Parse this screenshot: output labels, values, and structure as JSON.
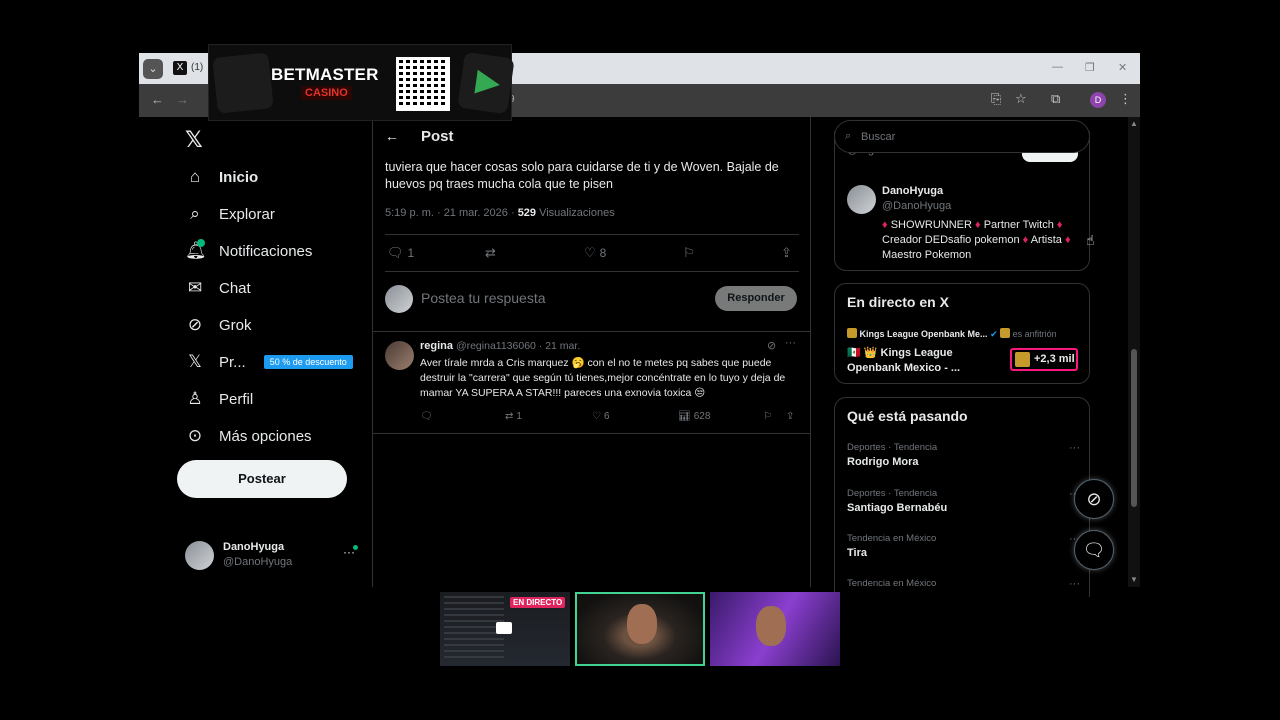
{
  "browser": {
    "tab_count": "(1)",
    "url_fragment": "9",
    "profile_initial": "D"
  },
  "ad": {
    "brand": "BETMASTER",
    "sub": "CASINO"
  },
  "sidebar": {
    "items": [
      {
        "label": "Inicio",
        "icon": "home-icon",
        "glyph": "⌂"
      },
      {
        "label": "Explorar",
        "icon": "search-icon",
        "glyph": "⌕"
      },
      {
        "label": "Notificaciones",
        "icon": "bell-icon",
        "glyph": "♫"
      },
      {
        "label": "Chat",
        "icon": "mail-icon",
        "glyph": "✉"
      },
      {
        "label": "Grok",
        "icon": "grok-icon",
        "glyph": "⊘"
      },
      {
        "label": "Pr...",
        "icon": "x-premium-icon",
        "glyph": "𝕏",
        "badge": "50 % de descuento"
      },
      {
        "label": "Perfil",
        "icon": "person-icon",
        "glyph": "♙"
      },
      {
        "label": "Más opciones",
        "icon": "more-circle-icon",
        "glyph": "⋯"
      }
    ],
    "post_button": "Postear",
    "account": {
      "name": "DanoHyuga",
      "handle": "@DanoHyuga"
    }
  },
  "post": {
    "header": "Post",
    "body": "tuviera que hacer cosas solo para cuidarse de ti y de Woven. Bajale de huevos pq traes mucha cola que te pisen",
    "time": "5:19 p. m. · 21 mar. 2026 · ",
    "views_count": "529",
    "views_label": " Visualizaciones",
    "replies": "1",
    "likes": "8",
    "reply_placeholder": "Postea tu respuesta",
    "reply_button": "Responder"
  },
  "reply": {
    "name": "regina",
    "handle": "@regina1136060 · 21 mar.",
    "text": "Aver tírale mrda a Cris marquez 🥱 con el no te metes pq sabes que puede destruir la \"carrera\" que según tú tienes,mejor concéntrate en lo tuyo y deja de mamar YA SUPERA A STAR!!! pareces una exnovia toxica 😒",
    "retweets": "1",
    "likes": "6",
    "views": "628"
  },
  "right": {
    "search_placeholder": "Buscar",
    "partial_handle": "@regina1136060",
    "profile": {
      "name": "DanoHyuga",
      "handle": "@DanoHyuga",
      "bio_1": "SHOWRUNNER",
      "bio_2": "Partner Twitch",
      "bio_3": "Creador DEDsafio pokemon",
      "bio_4": "Artista",
      "bio_5": "Maestro Pokemon"
    },
    "live": {
      "title": "En directo en X",
      "host": "Kings League Openbank Me...",
      "host_suffix": "es anfitrión",
      "event": "🇲🇽 👑 Kings League Openbank Mexico - ...",
      "count": "+2,3 mil"
    },
    "trends_title": "Qué está pasando",
    "trends": [
      {
        "context": "Deportes · Tendencia",
        "title": "Rodrigo Mora"
      },
      {
        "context": "Deportes · Tendencia",
        "title": "Santiago Bernabéu"
      },
      {
        "context": "Tendencia en México",
        "title": "Tira"
      },
      {
        "context": "Tendencia en México",
        "title": ""
      }
    ]
  },
  "stream": {
    "live_badge": "EN DIRECTO"
  }
}
